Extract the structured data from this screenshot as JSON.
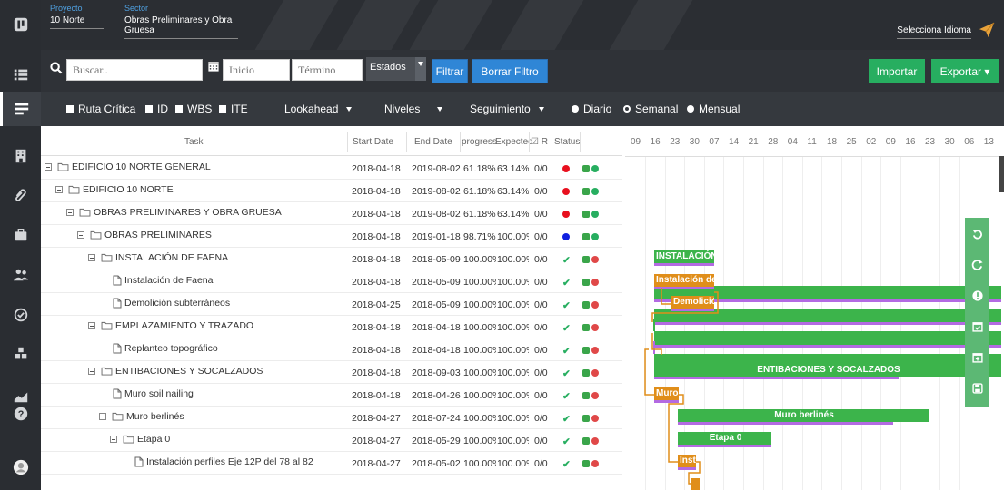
{
  "header": {
    "project_label": "Proyecto",
    "project_value": "10 Norte",
    "sector_label": "Sector",
    "sector_value": "Obras Preliminares y Obra Gruesa",
    "language_select": "Selecciona Idioma"
  },
  "toolbar": {
    "search_placeholder": "Buscar..",
    "start_placeholder": "Inicio",
    "end_placeholder": "Término",
    "estados_label": "Estados",
    "filtrar_label": "Filtrar",
    "borrar_label": "Borrar Filtro",
    "importar_label": "Importar",
    "exportar_label": "Exportar ▾"
  },
  "filters": {
    "ruta_critica": "Ruta Crítica",
    "id": "ID",
    "wbs": "WBS",
    "ite": "ITE",
    "lookahead": "Lookahead",
    "niveles": "Niveles",
    "seguimiento": "Seguimiento",
    "diario": "Diario",
    "semanal": "Semanal",
    "mensual": "Mensual"
  },
  "grid_headers": {
    "task": "Task",
    "start": "Start Date",
    "end": "End Date",
    "progress": "progress",
    "expected": "Expected",
    "r": "☑ R",
    "status": "Status"
  },
  "rows": [
    {
      "task": "EDIFICIO 10 NORTE GENERAL",
      "start": "2018-04-18",
      "end": "2019-08-02",
      "progress": "61.18%",
      "expected": "63.14%",
      "r": "0/0",
      "status": "red"
    },
    {
      "task": "EDIFICIO 10 NORTE",
      "start": "2018-04-18",
      "end": "2019-08-02",
      "progress": "61.18%",
      "expected": "63.14%",
      "r": "0/0",
      "status": "red"
    },
    {
      "task": "OBRAS PRELIMINARES Y OBRA GRUESA",
      "start": "2018-04-18",
      "end": "2019-08-02",
      "progress": "61.18%",
      "expected": "63.14%",
      "r": "0/0",
      "status": "red"
    },
    {
      "task": "OBRAS PRELIMINARES",
      "start": "2018-04-18",
      "end": "2019-01-18",
      "progress": "98.71%",
      "expected": "100.00%",
      "r": "0/0",
      "status": "blue"
    },
    {
      "task": "INSTALACIÓN DE FAENA",
      "start": "2018-04-18",
      "end": "2018-05-09",
      "progress": "100.00%",
      "expected": "100.00%",
      "r": "0/0",
      "status": "check"
    },
    {
      "task": "Instalación de Faena",
      "start": "2018-04-18",
      "end": "2018-05-09",
      "progress": "100.00%",
      "expected": "100.00%",
      "r": "0/0",
      "status": "check"
    },
    {
      "task": "Demolición subterráneos",
      "start": "2018-04-25",
      "end": "2018-05-09",
      "progress": "100.00%",
      "expected": "100.00%",
      "r": "0/0",
      "status": "check"
    },
    {
      "task": "EMPLAZAMIENTO Y TRAZADO",
      "start": "2018-04-18",
      "end": "2018-04-18",
      "progress": "100.00%",
      "expected": "100.00%",
      "r": "0/0",
      "status": "check"
    },
    {
      "task": "Replanteo topográfico",
      "start": "2018-04-18",
      "end": "2018-04-18",
      "progress": "100.00%",
      "expected": "100.00%",
      "r": "0/0",
      "status": "check"
    },
    {
      "task": "ENTIBACIONES Y SOCALZADOS",
      "start": "2018-04-18",
      "end": "2018-09-03",
      "progress": "100.00%",
      "expected": "100.00%",
      "r": "0/0",
      "status": "check"
    },
    {
      "task": "Muro soil nailing",
      "start": "2018-04-18",
      "end": "2018-04-26",
      "progress": "100.00%",
      "expected": "100.00%",
      "r": "0/0",
      "status": "check"
    },
    {
      "task": "Muro berlinés",
      "start": "2018-04-27",
      "end": "2018-07-24",
      "progress": "100.00%",
      "expected": "100.00%",
      "r": "0/0",
      "status": "check"
    },
    {
      "task": "Etapa 0",
      "start": "2018-04-27",
      "end": "2018-05-29",
      "progress": "100.00%",
      "expected": "100.00%",
      "r": "0/0",
      "status": "check"
    },
    {
      "task": "Instalación perfiles Eje 12P del 78 al 82",
      "start": "2018-04-27",
      "end": "2018-05-02",
      "progress": "100.00%",
      "expected": "100.00%",
      "r": "0/0",
      "status": "check"
    }
  ],
  "gantt": {
    "dates": [
      "09",
      "16",
      "23",
      "30",
      "07",
      "14",
      "21",
      "28",
      "04",
      "11",
      "18",
      "25",
      "02",
      "09",
      "16",
      "23",
      "30",
      "06",
      "13"
    ],
    "bar_labels": {
      "instalacion_group": "INSTALACIÓN D",
      "instalacion_task": "Instalación de Fa",
      "demolicion": "Demolición",
      "entibaciones": "ENTIBACIONES Y SOCALZADOS",
      "muro_soil": "Muro s",
      "muro_berlines": "Muro berlinés",
      "etapa0": "Etapa 0",
      "instalacion_perfiles": "Insta"
    }
  },
  "colors": {
    "sidebar_bg": "#2a2d32",
    "header_bg": "#2b2e33",
    "primary_blue": "#2f86d6",
    "success_green": "#27ae60",
    "gantt_green": "#3cb44b",
    "gantt_orange": "#e08e1a",
    "progress_purple": "#b36ae2",
    "status_red": "#e8101e",
    "status_blue": "#1020e0"
  },
  "icons": {
    "sidebar": [
      "logo-icon",
      "list-icon",
      "gantt-icon",
      "building-icon",
      "paperclip-icon",
      "briefcase-icon",
      "users-icon",
      "check-circle-icon",
      "cubes-icon",
      "chart-icon",
      "help-icon",
      "user-avatar-icon"
    ],
    "right_tools": [
      "undo-icon",
      "refresh-icon",
      "alert-icon",
      "calendar-check-icon",
      "calendar-plus-icon",
      "save-icon"
    ]
  }
}
